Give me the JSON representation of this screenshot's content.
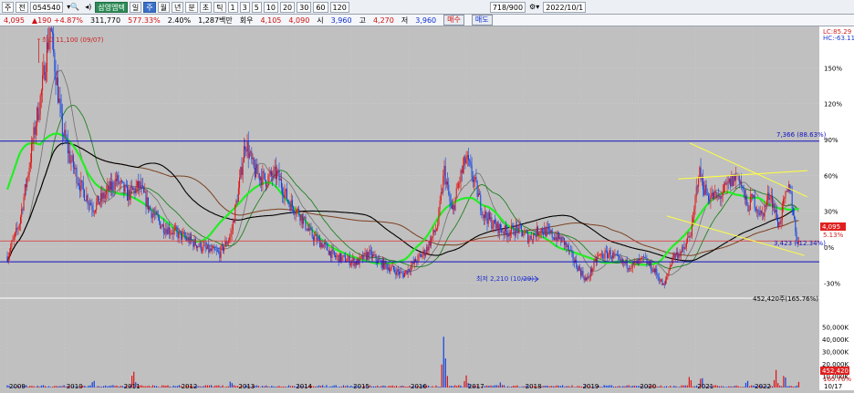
{
  "toolbar": {
    "chart_type": "주",
    "market": "전",
    "code": "054540",
    "name": "삼영엠텍",
    "periods": [
      "일",
      "주",
      "월",
      "년",
      "분",
      "초",
      "틱"
    ],
    "minutes": [
      "1",
      "3",
      "5",
      "10",
      "20",
      "30",
      "60",
      "120"
    ],
    "count": "718/900",
    "date": "2022/10/1",
    "icons": [
      "search-icon",
      "speaker-icon",
      "settings-icon"
    ]
  },
  "quote": {
    "price": "4,095",
    "change": "190",
    "change_pct": "+4.87%",
    "volume": "311,770",
    "volume_ratio": "577.33%",
    "turnover": "2.40%",
    "amount": "1,287백만",
    "ask_label": "회우",
    "ask": "4,105",
    "bid": "4,090",
    "open_label": "시",
    "open": "3,960",
    "high_label": "고",
    "high": "4,270",
    "low_label": "저",
    "low": "3,960",
    "buy_btn": "매수",
    "sell_btn": "매도"
  },
  "legend": {
    "lc": "LC:85.29",
    "hc": "HC:-63.11"
  },
  "annotations": {
    "high": "최고 11,100 (09/07)",
    "low": "최저 2,210 (10/29)",
    "upper_line": "7,366 (88.63%)",
    "lower_line": "3,423 (-12.34%)",
    "price_box": "4,095",
    "price_pct": "5.13%",
    "volume_max": "452,420주(165.76%)",
    "volume_box": "452,420",
    "volume_pct": "165.76%"
  },
  "colors": {
    "up": "#e01010",
    "down": "#1040e0",
    "ma_green": "#22ee22",
    "trend_yellow": "#ffff40",
    "hline_blue": "#1010c0",
    "hline_red": "#e03030"
  },
  "chart_data": {
    "type": "candlestick",
    "x_ticks": [
      "2009",
      "2010",
      "2011",
      "2012",
      "2013",
      "2014",
      "2015",
      "2016",
      "2017",
      "2018",
      "2019",
      "2020",
      "2021",
      "2022",
      "10/17"
    ],
    "y_ticks": [
      "150%",
      "120%",
      "90%",
      "60%",
      "30%",
      "0%",
      "-30%"
    ],
    "volume_ticks": [
      "50,000K",
      "40,000K",
      "30,000K",
      "20,000K",
      "10,000K"
    ],
    "price_path": [
      [
        2009.0,
        3.6
      ],
      [
        2009.2,
        4.6
      ],
      [
        2009.35,
        6.2
      ],
      [
        2009.5,
        8.0
      ],
      [
        2009.6,
        9.0
      ],
      [
        2009.7,
        10.5
      ],
      [
        2009.75,
        11.1
      ],
      [
        2009.85,
        9.5
      ],
      [
        2009.95,
        7.8
      ],
      [
        2010.1,
        6.8
      ],
      [
        2010.3,
        5.8
      ],
      [
        2010.5,
        5.2
      ],
      [
        2010.7,
        5.6
      ],
      [
        2010.9,
        6.1
      ],
      [
        2011.1,
        5.6
      ],
      [
        2011.3,
        5.9
      ],
      [
        2011.5,
        5.1
      ],
      [
        2011.7,
        4.6
      ],
      [
        2011.9,
        4.4
      ],
      [
        2012.1,
        4.2
      ],
      [
        2012.3,
        4.0
      ],
      [
        2012.5,
        3.8
      ],
      [
        2012.7,
        3.7
      ],
      [
        2012.9,
        4.3
      ],
      [
        2013.05,
        6.0
      ],
      [
        2013.15,
        7.4
      ],
      [
        2013.3,
        6.4
      ],
      [
        2013.5,
        6.1
      ],
      [
        2013.7,
        6.3
      ],
      [
        2013.9,
        5.4
      ],
      [
        2014.1,
        5.0
      ],
      [
        2014.3,
        4.3
      ],
      [
        2014.5,
        4.0
      ],
      [
        2014.7,
        3.6
      ],
      [
        2014.9,
        3.5
      ],
      [
        2015.1,
        3.4
      ],
      [
        2015.3,
        3.7
      ],
      [
        2015.5,
        3.4
      ],
      [
        2015.7,
        3.2
      ],
      [
        2015.9,
        3.0
      ],
      [
        2016.1,
        3.4
      ],
      [
        2016.3,
        3.8
      ],
      [
        2016.5,
        4.6
      ],
      [
        2016.62,
        6.4
      ],
      [
        2016.75,
        5.0
      ],
      [
        2016.9,
        6.2
      ],
      [
        2017.0,
        6.8
      ],
      [
        2017.15,
        6.0
      ],
      [
        2017.3,
        5.0
      ],
      [
        2017.5,
        4.6
      ],
      [
        2017.7,
        4.4
      ],
      [
        2017.9,
        4.5
      ],
      [
        2018.1,
        4.2
      ],
      [
        2018.3,
        4.5
      ],
      [
        2018.5,
        4.3
      ],
      [
        2018.7,
        4.1
      ],
      [
        2018.9,
        3.4
      ],
      [
        2019.1,
        2.8
      ],
      [
        2019.3,
        3.6
      ],
      [
        2019.5,
        3.7
      ],
      [
        2019.7,
        3.4
      ],
      [
        2019.9,
        3.3
      ],
      [
        2020.1,
        3.5
      ],
      [
        2020.3,
        3.1
      ],
      [
        2020.45,
        2.6
      ],
      [
        2020.6,
        3.6
      ],
      [
        2020.8,
        3.8
      ],
      [
        2020.95,
        4.6
      ],
      [
        2021.05,
        6.4
      ],
      [
        2021.2,
        5.6
      ],
      [
        2021.4,
        5.5
      ],
      [
        2021.6,
        6.0
      ],
      [
        2021.75,
        6.3
      ],
      [
        2021.9,
        5.2
      ],
      [
        2022.0,
        5.5
      ],
      [
        2022.15,
        4.9
      ],
      [
        2022.3,
        5.7
      ],
      [
        2022.45,
        4.6
      ],
      [
        2022.55,
        5.4
      ],
      [
        2022.65,
        5.9
      ],
      [
        2022.75,
        4.3
      ],
      [
        2022.8,
        4.1
      ]
    ],
    "volume_peaks": [
      [
        2010.5,
        8
      ],
      [
        2011.2,
        22
      ],
      [
        2012.9,
        7
      ],
      [
        2016.6,
        52
      ],
      [
        2016.65,
        30
      ],
      [
        2017.0,
        14
      ],
      [
        2017.6,
        5
      ],
      [
        2020.9,
        11
      ],
      [
        2021.1,
        13
      ],
      [
        2021.9,
        9
      ],
      [
        2022.4,
        18
      ],
      [
        2022.55,
        16
      ],
      [
        2022.8,
        5
      ]
    ]
  }
}
